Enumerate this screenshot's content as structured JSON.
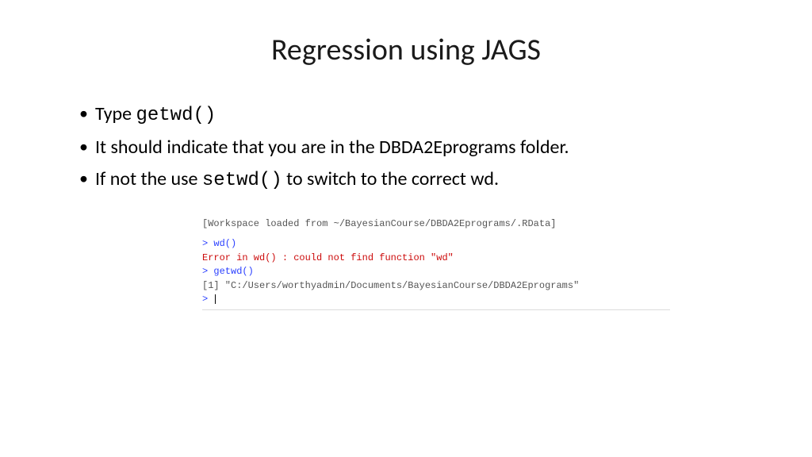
{
  "title": "Regression using JAGS",
  "bullets": {
    "b1_pre": "Type ",
    "b1_code": "getwd()",
    "b2": "It should indicate that you are in the DBDA2Eprograms folder.",
    "b3_pre": "If not the use ",
    "b3_code": "setwd()",
    "b3_post": " to switch to the correct wd."
  },
  "console": {
    "line1": "[Workspace loaded from ~/BayesianCourse/DBDA2Eprograms/.RData]",
    "prompt": "> ",
    "wd_call": "wd()",
    "error_line": "Error in wd() : could not find function \"wd\"",
    "getwd_call": "getwd()",
    "result": "[1] \"C:/Users/worthyadmin/Documents/BayesianCourse/DBDA2Eprograms\""
  }
}
